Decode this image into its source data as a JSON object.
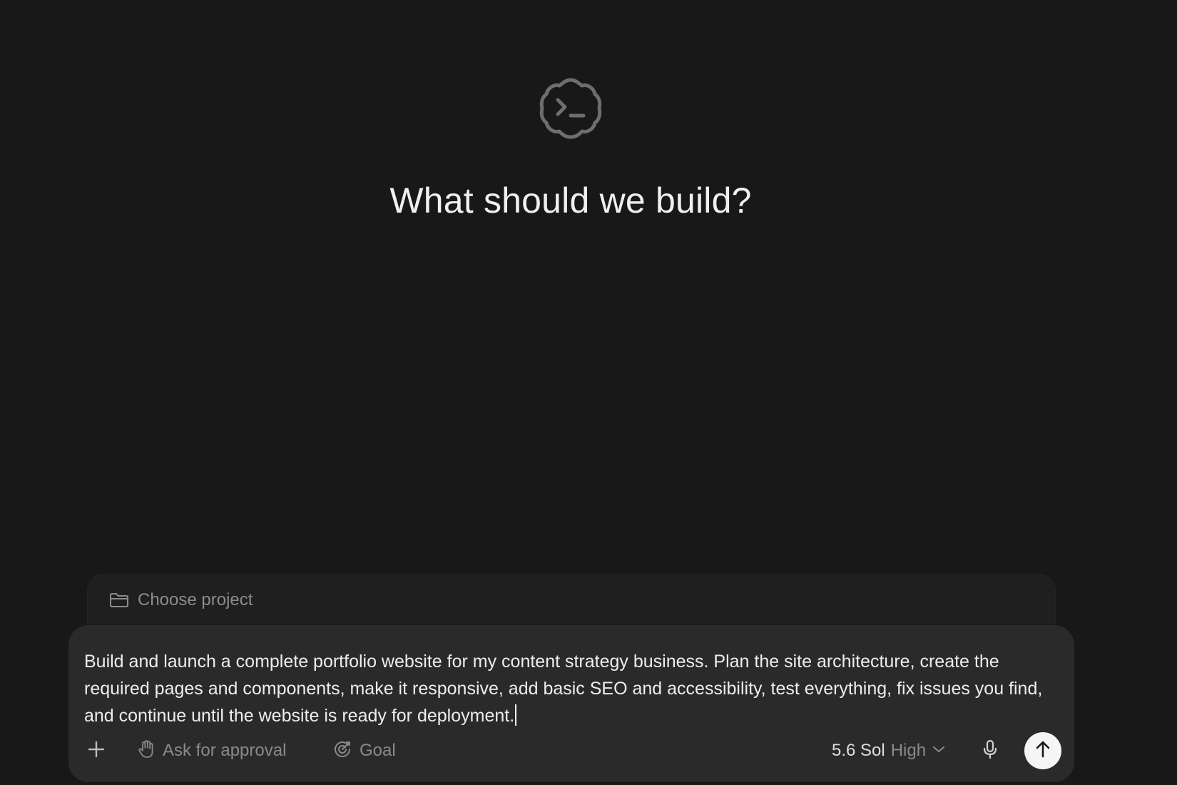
{
  "hero": {
    "icon": "terminal-prompt-icon",
    "title": "What should we build?"
  },
  "project": {
    "icon": "folder-icon",
    "label": "Choose project"
  },
  "composer": {
    "prompt": "Build and launch a complete portfolio website for my content strategy business. Plan the site architecture, create the required pages and components, make it responsive, add basic SEO and accessibility, test everything, fix issues you find, and continue until the website is ready for deployment.",
    "toolbar": {
      "add_icon": "plus-icon",
      "approval_icon": "hand-icon",
      "approval_label": "Ask for approval",
      "goal_icon": "goal-icon",
      "goal_label": "Goal",
      "model_name": "5.6 Sol",
      "model_effort": "High",
      "model_dropdown_icon": "chevron-down-icon",
      "mic_icon": "microphone-icon",
      "send_icon": "arrow-up-icon"
    }
  },
  "colors": {
    "background": "#181818",
    "composer": "#2a2a2a",
    "muted_text": "#8a8a8a",
    "send_button": "#f5f5f5"
  }
}
